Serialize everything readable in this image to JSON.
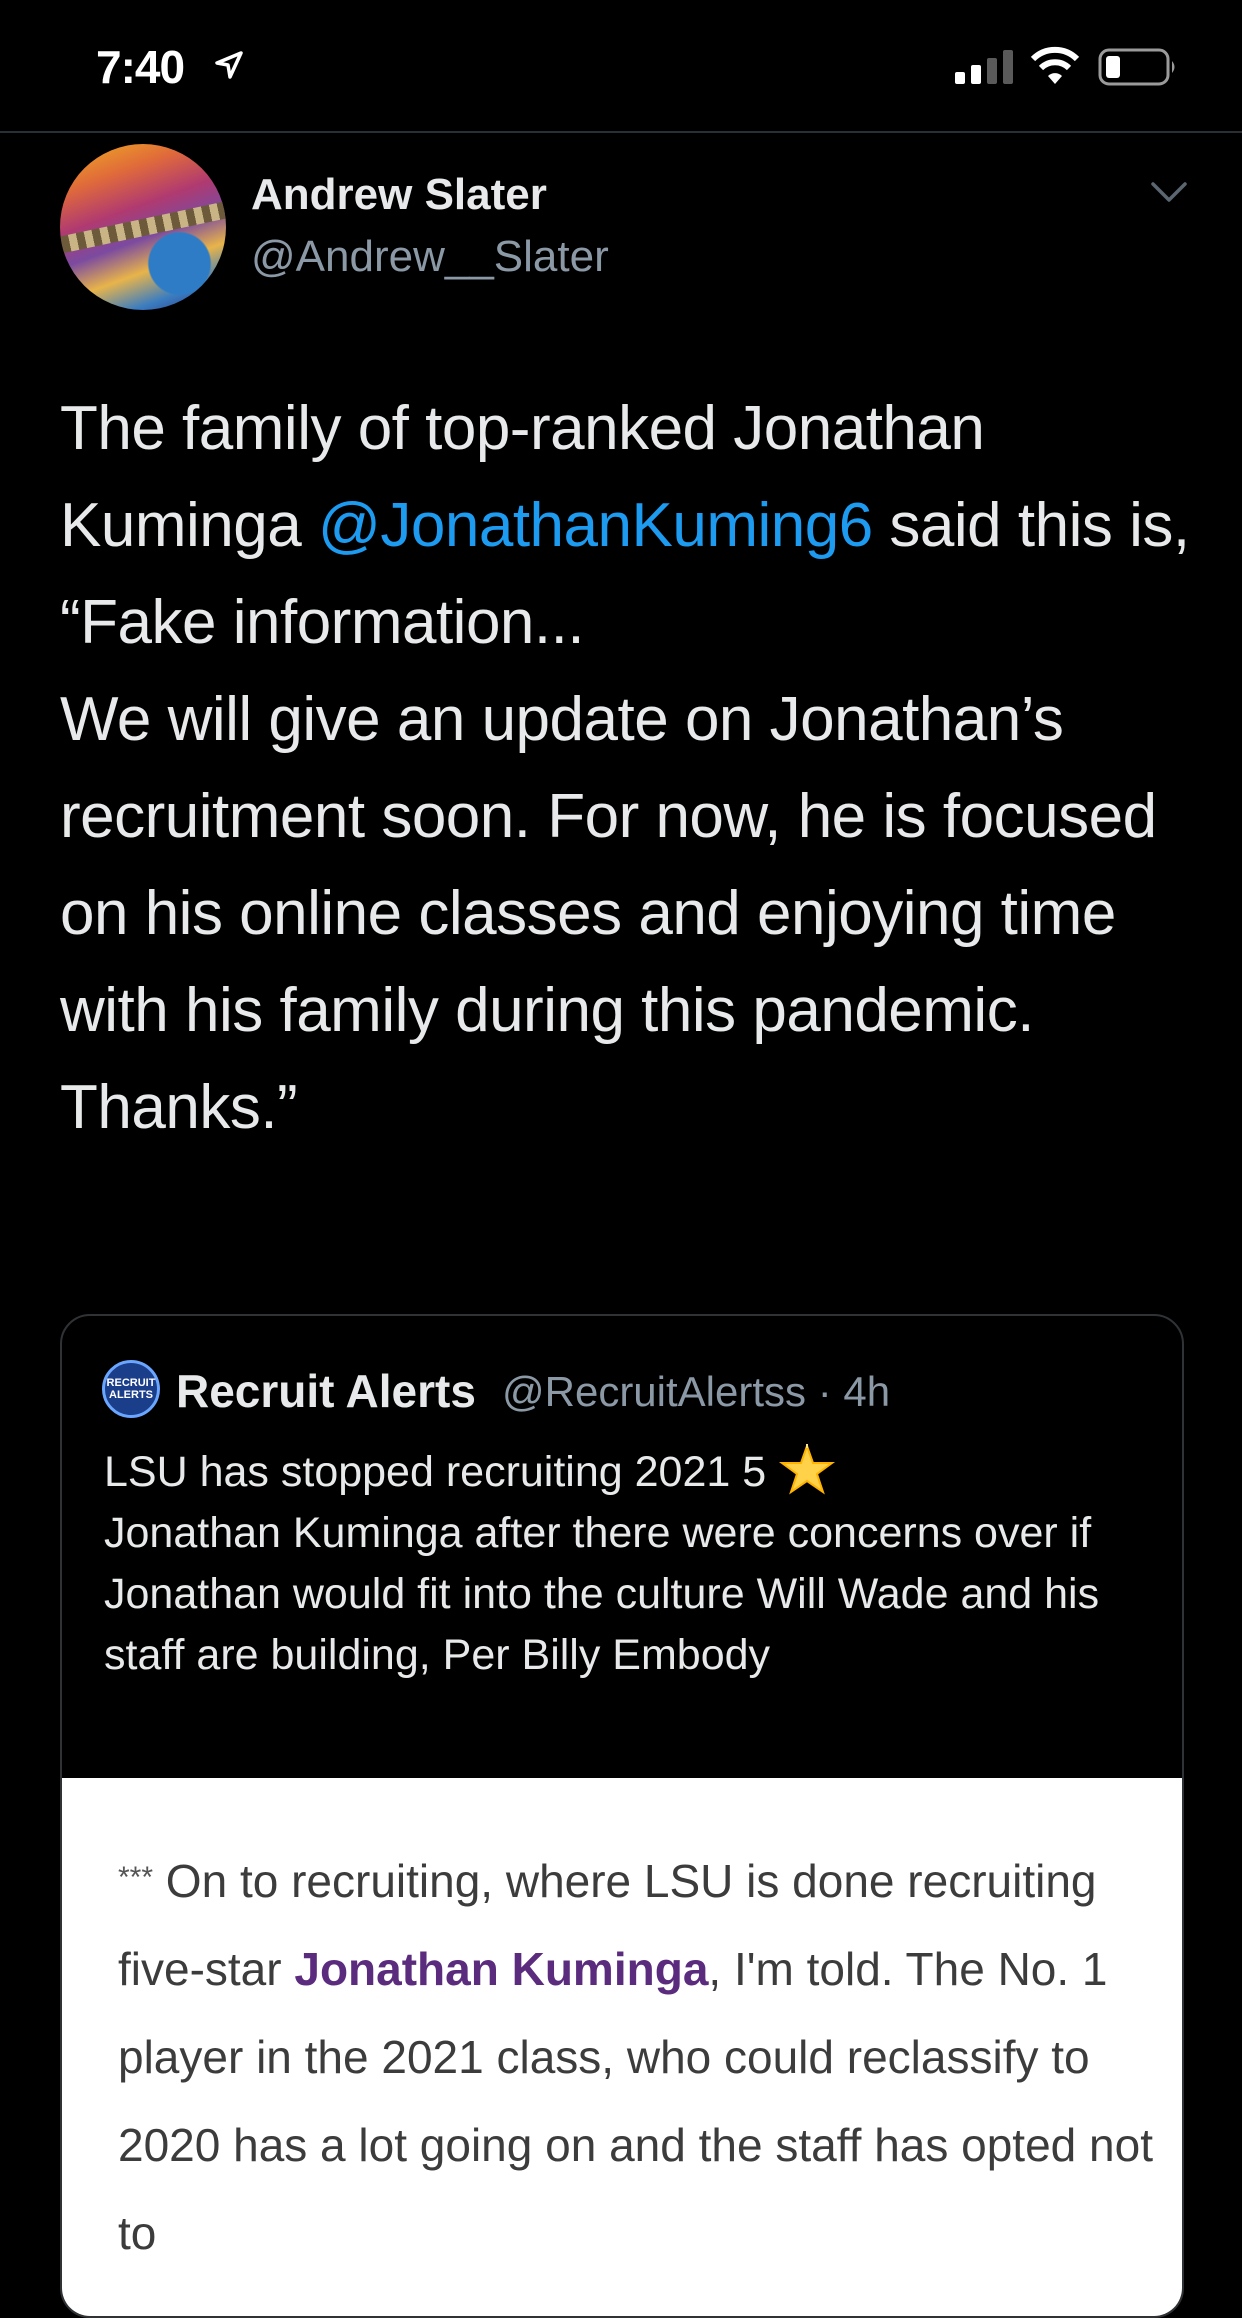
{
  "status_bar": {
    "time": "7:40",
    "icons": [
      "location-arrow-icon",
      "signal-icon",
      "wifi-icon",
      "battery-icon"
    ]
  },
  "tweet": {
    "author_name": "Andrew Slater",
    "author_handle": "@Andrew__Slater",
    "text_part1": "The family of top-ranked Jonathan Kuminga ",
    "mention": "@JonathanKuming6",
    "text_part2": " said this is,\n“Fake information...\nWe will give an update on Jonathan’s recruitment soon. For now, he is focused on his online classes and enjoying time with his family during this pandemic. Thanks.”",
    "mention_color": "#1d9bf0"
  },
  "quoted_tweet": {
    "avatar_text": "RECRUIT ALERTS",
    "author_name": "Recruit Alerts",
    "author_handle": "@RecruitAlertss · 4h",
    "text_part1": "LSU has stopped recruiting 2021 5",
    "star": "🌟",
    "text_part2": "Jonathan Kuminga after there were concerns over if Jonathan would fit into the culture Will Wade and his staff are building, Per Billy Embody",
    "image_text": {
      "stars": "***",
      "part1": " On to recruiting, where LSU is done recruiting five-star ",
      "name": "Jonathan Kuminga",
      "part2": ", I'm told. The No. 1 player in the 2021 class, who could reclassify to 2020 has a lot going on and the staff has opted not to"
    }
  }
}
